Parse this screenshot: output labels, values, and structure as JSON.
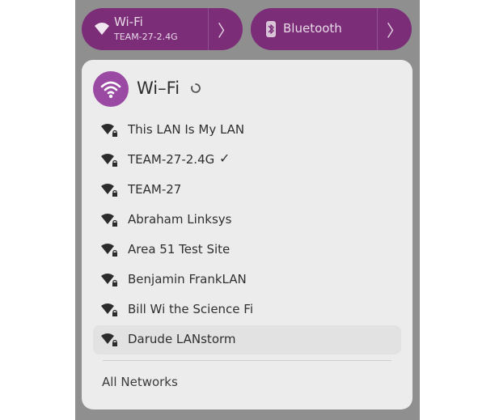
{
  "quick_toggles": {
    "wifi": {
      "title": "Wi-Fi",
      "subtitle": "TEAM-27-2.4G",
      "icon": "wifi-icon",
      "arrow": "〉"
    },
    "bluetooth": {
      "title": "Bluetooth",
      "icon": "bluetooth-icon",
      "arrow": "〉"
    }
  },
  "wifi_menu": {
    "title": "Wi–Fi",
    "networks": [
      {
        "name": "This LAN Is My LAN",
        "connected": false
      },
      {
        "name": "TEAM-27-2.4G",
        "connected": true,
        "check": "✓"
      },
      {
        "name": "TEAM-27",
        "connected": false
      },
      {
        "name": "Abraham Linksys",
        "connected": false
      },
      {
        "name": "Area 51 Test Site",
        "connected": false
      },
      {
        "name": "Benjamin FrankLAN",
        "connected": false
      },
      {
        "name": "Bill Wi the Science Fi",
        "connected": false
      },
      {
        "name": "Darude LANstorm",
        "connected": false,
        "hovered": true
      }
    ],
    "all_networks_label": "All Networks"
  },
  "colors": {
    "accent": "#7b2d78",
    "accent_circle": "#9a4aa3",
    "menu_bg": "#ececec",
    "panel_bg": "#8f8f8f"
  }
}
